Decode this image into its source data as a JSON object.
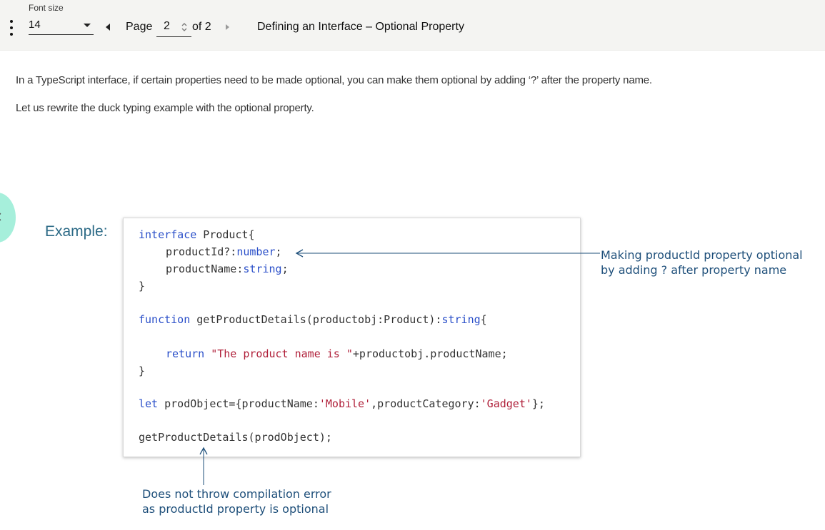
{
  "toolbar": {
    "font_size_label": "Font size",
    "font_size_value": "14",
    "page_label": "Page",
    "page_value": "2",
    "of_label": "of 2",
    "document_title": "Defining an Interface – Optional Property"
  },
  "content": {
    "paragraph_1": "In a TypeScript interface, if certain properties need to be made optional, you can make them optional by adding ‘?’ after the property name.",
    "paragraph_2": "Let us rewrite the duck typing example with the optional property.",
    "example_label": "Example:"
  },
  "code": {
    "l1_kw": "interface",
    "l1_rest": " Product{",
    "l2_a": "productId?:",
    "l2_type": "number",
    "l2_end": ";",
    "l3_a": "productName:",
    "l3_type": "string",
    "l3_end": ";",
    "l4": "}",
    "l5_kw": "function",
    "l5_a": " getProductDetails(productobj:Product):",
    "l5_type": "string",
    "l5_end": "{",
    "l6_kw": "return",
    "l6_space": " ",
    "l6_str": "\"The product name is \"",
    "l6_rest": "+productobj.productName;",
    "l7": "}",
    "l8_kw": "let",
    "l8_a": " prodObject={productName:",
    "l8_s1": "'Mobile'",
    "l8_b": ",productCategory:",
    "l8_s2": "'Gadget'",
    "l8_c": "};",
    "l9": "getProductDetails(prodObject);"
  },
  "annotations": {
    "right_line_1": "Making productId property optional",
    "right_line_2": "by adding ? after property name",
    "bottom_line_1": "Does not throw compilation error",
    "bottom_line_2": "as productId property is optional"
  },
  "colors": {
    "toolbar_bg": "#f4f4f2",
    "keyword": "#2a4fc9",
    "string": "#b0203a",
    "annotation": "#1e4f7a",
    "fab": "#a6efdb"
  },
  "icons": [
    "more-vert-icon",
    "dropdown-caret-icon",
    "prev-page-icon",
    "spinner-icon",
    "next-page-icon",
    "chevron-left-icon"
  ]
}
